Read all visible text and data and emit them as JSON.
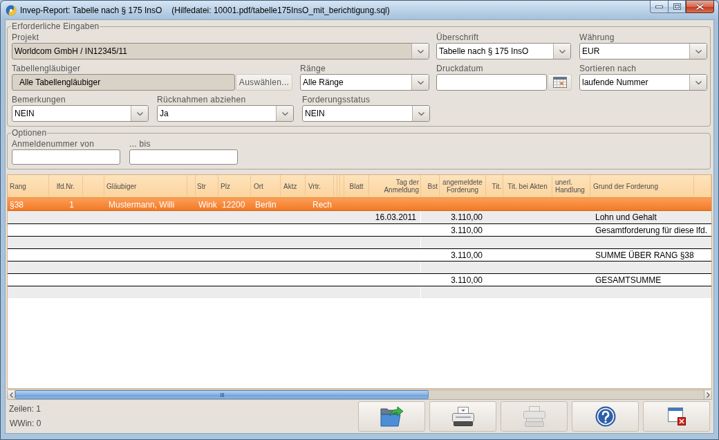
{
  "window": {
    "title": "Invep-Report: Tabelle nach § 175 InsO",
    "help_file": "(Hilfedatei: 10001.pdf/tabelle175InsO_mit_berichtigung.sql)"
  },
  "required_inputs": {
    "legend": "Erforderliche Eingaben",
    "fields": [
      {
        "kind": "combo",
        "label": "Projekt",
        "value": "Worldcom GmbH / IN12345/11",
        "disabled": true
      },
      {
        "kind": "combo",
        "label": "Überschrift",
        "value": "Tabelle nach § 175 InsO",
        "disabled": false
      },
      {
        "kind": "combo",
        "label": "Währung",
        "value": "EUR",
        "disabled": false
      },
      {
        "kind": "picker",
        "label": "Tabellengläubiger",
        "value": "Alle Tabellengläubiger",
        "button": "Auswählen...",
        "disabled": true
      },
      {
        "kind": "combo",
        "label": "Ränge",
        "value": "Alle Ränge",
        "disabled": false
      },
      {
        "kind": "date",
        "label": "Druckdatum",
        "disabled": false
      },
      {
        "kind": "combo",
        "label": "Sortieren nach",
        "value": "laufende Nummer",
        "disabled": false
      },
      {
        "kind": "combo",
        "label": "Bemerkungen",
        "value": "NEIN",
        "disabled": false
      },
      {
        "kind": "combo",
        "label": "Rücknahmen abziehen",
        "value": "Ja",
        "disabled": false
      },
      {
        "kind": "combo",
        "label": "Forderungsstatus",
        "value": "NEIN",
        "disabled": false
      }
    ]
  },
  "options": {
    "legend": "Optionen",
    "fields": [
      {
        "kind": "text",
        "label": "Anmeldenummer von",
        "disabled": false
      },
      {
        "kind": "text",
        "label": "... bis",
        "disabled": false
      }
    ]
  },
  "table": {
    "columns": [
      "Rang",
      "lfd.Nr.",
      "Gläubiger",
      "Str",
      "Plz",
      "Ort",
      "Aktz",
      "Vrtr.",
      "Blatt",
      "Tag der Anmeldung",
      "Bst",
      "angemeldete Forderung",
      "Tit.",
      "Tit. bei Akten",
      "unerl. Handlung",
      "Grund der Forderung"
    ],
    "rows": [
      {
        "selected": true,
        "rang": "§38",
        "lfd_nr": "1",
        "glaeubiger": "Mustermann, Willi",
        "str": "Wink",
        "plz": "12200",
        "ort": "Berlin",
        "vrtr": "Rech"
      },
      {
        "selected": false,
        "tag_der_anmeldung": "16.03.2011",
        "angemeldete_forderung": "3.110,00",
        "grund_der_forderung": "Lohn und Gehalt"
      },
      {
        "selected": false,
        "angemeldete_forderung": "3.110,00",
        "grund_der_forderung": "Gesamtforderung für diese lfd."
      },
      {
        "selected": false
      },
      {
        "selected": false,
        "angemeldete_forderung": "3.110,00",
        "grund_der_forderung": "SUMME ÜBER RANG §38"
      },
      {
        "selected": false
      },
      {
        "selected": false,
        "angemeldete_forderung": "3.110,00",
        "grund_der_forderung": "GESAMTSUMME"
      },
      {
        "selected": false
      }
    ]
  },
  "status": {
    "row_count": "Zeilen: 1",
    "wwin": "WWin: 0"
  },
  "actions": [
    {
      "kind": "export",
      "disabled": false
    },
    {
      "kind": "print",
      "disabled": false
    },
    {
      "kind": "print_all",
      "disabled": true
    },
    {
      "kind": "help",
      "disabled": false
    },
    {
      "kind": "close",
      "disabled": false
    }
  ]
}
